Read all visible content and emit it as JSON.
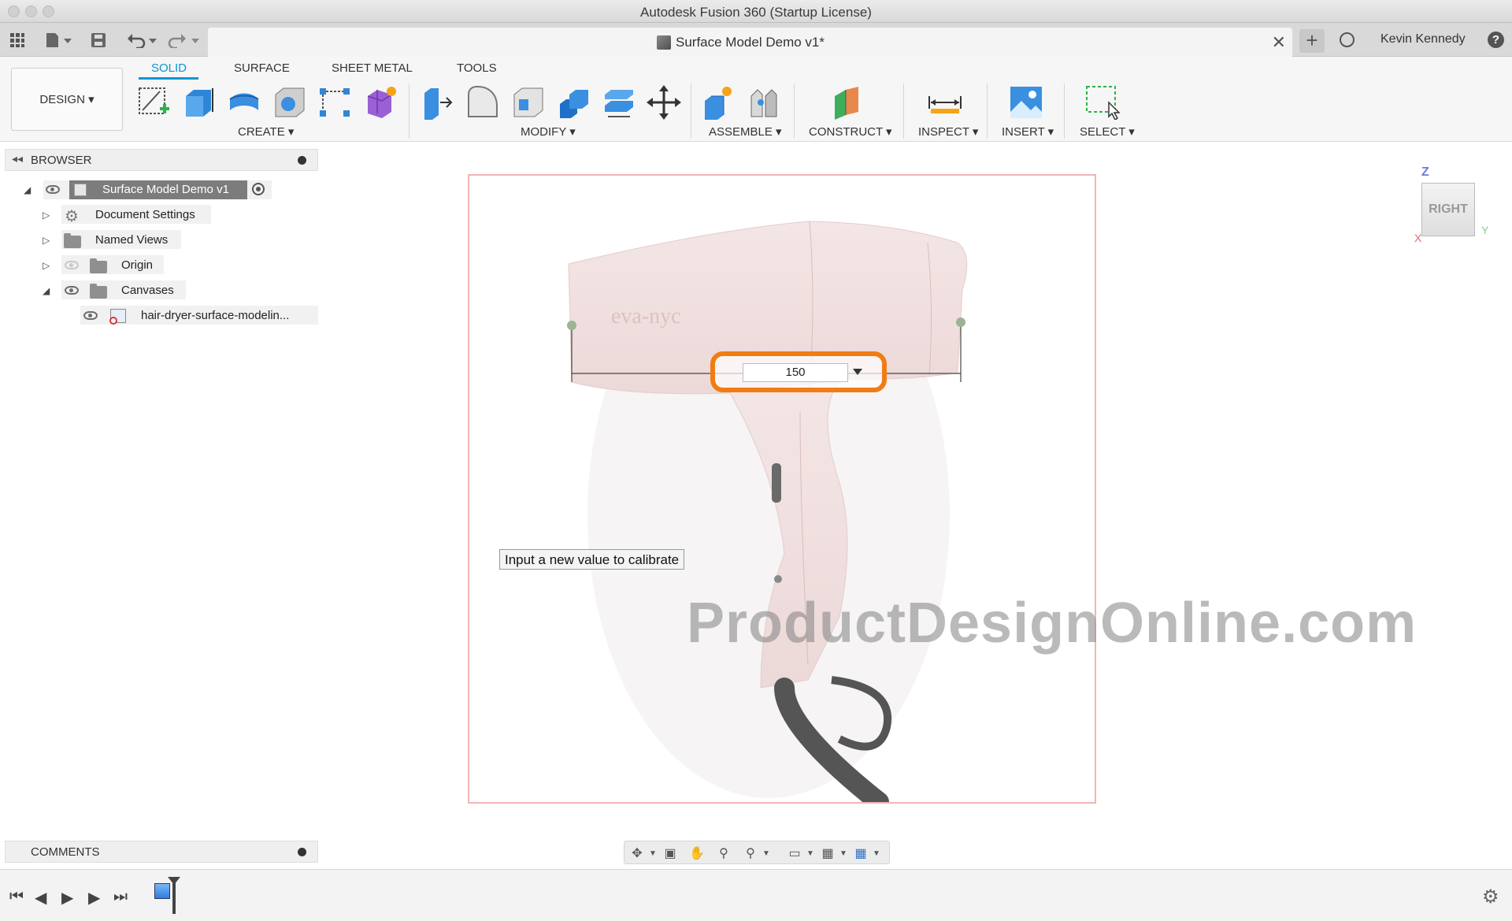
{
  "window": {
    "title": "Autodesk Fusion 360 (Startup License)"
  },
  "tabbar": {
    "document_title": "Surface Model Demo v1*",
    "close_glyph": "✕",
    "new_tab_glyph": "+",
    "user_name": "Kevin Kennedy",
    "help_glyph": "?"
  },
  "toolbar": {
    "workspace_label": "DESIGN ▾",
    "tabs": [
      {
        "label": "SOLID",
        "active": true
      },
      {
        "label": "SURFACE",
        "active": false
      },
      {
        "label": "SHEET METAL",
        "active": false
      },
      {
        "label": "TOOLS",
        "active": false
      }
    ],
    "groups": {
      "create": "CREATE ▾",
      "modify": "MODIFY ▾",
      "assemble": "ASSEMBLE ▾",
      "construct": "CONSTRUCT ▾",
      "inspect": "INSPECT ▾",
      "insert": "INSERT ▾",
      "select": "SELECT ▾"
    },
    "icons": [
      "create-sketch-icon",
      "extrude-icon",
      "revolve-icon",
      "hole-icon",
      "pattern-icon",
      "create-form-icon",
      "press-pull-icon",
      "fillet-icon",
      "shell-icon",
      "combine-icon",
      "offset-plane-icon",
      "move-icon",
      "new-component-icon",
      "joint-icon",
      "construct-plane-icon",
      "measure-icon",
      "insert-canvas-icon",
      "select-icon"
    ]
  },
  "browser": {
    "title": "BROWSER",
    "root": "Surface Model Demo v1",
    "items": [
      {
        "label": "Document Settings",
        "icon": "gear-icon"
      },
      {
        "label": "Named Views",
        "icon": "folder-icon"
      },
      {
        "label": "Origin",
        "icon": "folder-icon"
      },
      {
        "label": "Canvases",
        "icon": "folder-icon"
      }
    ],
    "canvas_item": "hair-dryer-surface-modelin..."
  },
  "viewport": {
    "dimension_value": "150",
    "tooltip": "Input a new value to calibrate",
    "watermark": "ProductDesignOnline.com",
    "viewcube_face": "RIGHT",
    "axis_z": "Z",
    "axis_y": "Y",
    "axis_x": "X",
    "brand_text": "eva-nyc"
  },
  "comments": {
    "title": "COMMENTS"
  },
  "colors": {
    "accent": "#0696d7",
    "highlight": "#f07d13",
    "canvas_border": "#f1b5b5"
  }
}
